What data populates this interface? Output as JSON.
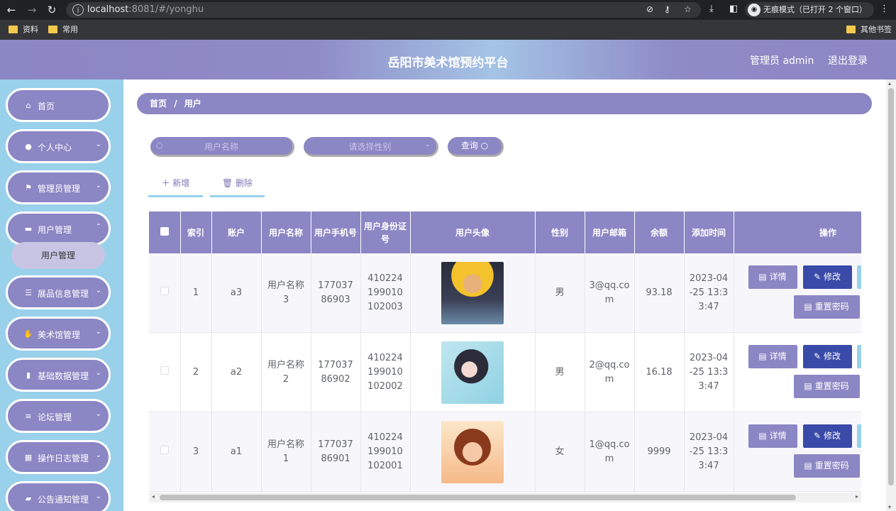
{
  "browser": {
    "url_host": "localhost",
    "url_rest": ":8081/#/yonghu",
    "incognito_label": "无痕模式（已打开 2 个窗口）",
    "bookmarks": [
      "资料",
      "常用"
    ],
    "other_bookmarks": "其他书签"
  },
  "header": {
    "title": "岳阳市美术馆预约平台",
    "admin": "管理员 admin",
    "logout": "退出登录"
  },
  "sidebar": {
    "items": [
      {
        "label": "首页",
        "icon": "home-icon"
      },
      {
        "label": "个人中心",
        "icon": "user-icon"
      },
      {
        "label": "管理员管理",
        "icon": "flag-icon"
      },
      {
        "label": "用户管理",
        "icon": "users-icon"
      },
      {
        "label": "展品信息管理",
        "icon": "list-icon"
      },
      {
        "label": "美术馆管理",
        "icon": "thumb-icon"
      },
      {
        "label": "基础数据管理",
        "icon": "bar-chart-icon"
      },
      {
        "label": "论坛管理",
        "icon": "sliders-icon"
      },
      {
        "label": "操作日志管理",
        "icon": "grid-icon"
      },
      {
        "label": "公告通知管理",
        "icon": "briefcase-icon"
      }
    ],
    "submenu": "用户管理"
  },
  "breadcrumb": {
    "home": "首页",
    "sep": "/",
    "current": "用户"
  },
  "search": {
    "name_placeholder": "用户名称",
    "gender_placeholder": "请选择性别",
    "query_label": "查询"
  },
  "actions": {
    "add": "新增",
    "delete": "删除"
  },
  "table": {
    "headers": [
      "索引",
      "账户",
      "用户名称",
      "用户手机号",
      "用户身份证号",
      "用户头像",
      "性别",
      "用户邮箱",
      "余额",
      "添加时间",
      "操作"
    ],
    "rows": [
      {
        "index": "1",
        "account": "a3",
        "name": "用户名称3",
        "phone": "17703786903",
        "id_card": "410224199010102003",
        "gender": "男",
        "email": "3@qq.com",
        "balance": "93.18",
        "time": "2023-04-25 13:33:47"
      },
      {
        "index": "2",
        "account": "a2",
        "name": "用户名称2",
        "phone": "17703786902",
        "id_card": "410224199010102002",
        "gender": "男",
        "email": "2@qq.com",
        "balance": "16.18",
        "time": "2023-04-25 13:33:47"
      },
      {
        "index": "3",
        "account": "a1",
        "name": "用户名称1",
        "phone": "17703786901",
        "id_card": "410224199010102001",
        "gender": "女",
        "email": "1@qq.com",
        "balance": "9999",
        "time": "2023-04-25 13:33:47"
      }
    ],
    "ops": {
      "detail": "详情",
      "edit": "修改",
      "reset": "重置密码"
    }
  },
  "colors": {
    "primary": "#8b86c4",
    "sidebar": "#99d0ea",
    "edit": "#3a4aa8"
  }
}
